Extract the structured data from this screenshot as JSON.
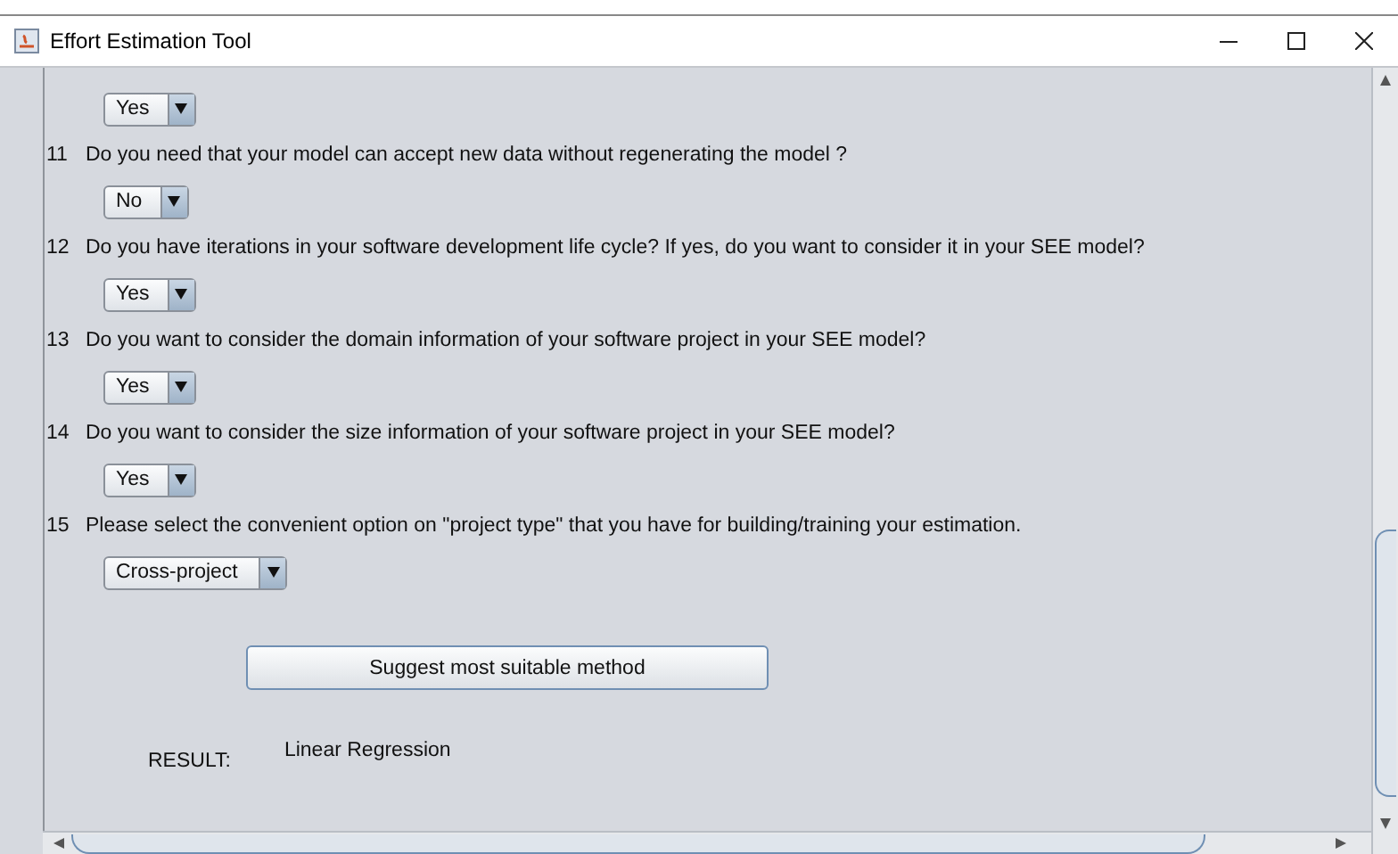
{
  "window": {
    "title": "Effort Estimation Tool"
  },
  "top_answer": "Yes",
  "questions": [
    {
      "number": "11",
      "question": "Do you need that your model can accept new data without regenerating the model ?",
      "answer": "No"
    },
    {
      "number": "12",
      "question": "Do you have iterations in your software development life cycle? If yes, do you want to consider it in your SEE model?",
      "answer": "Yes"
    },
    {
      "number": "13",
      "question": "Do you want to consider the domain information of your software project in your SEE model?",
      "answer": "Yes"
    },
    {
      "number": "14",
      "question": "Do you want to consider the size information of your software project in your SEE model?",
      "answer": "Yes"
    },
    {
      "number": "15",
      "question": "Please select the convenient option on \"project type\" that you have for building/training your estimation.",
      "answer": "Cross-project"
    }
  ],
  "button": "Suggest most suitable method",
  "result": {
    "label": "RESULT:",
    "value": "Linear Regression"
  }
}
